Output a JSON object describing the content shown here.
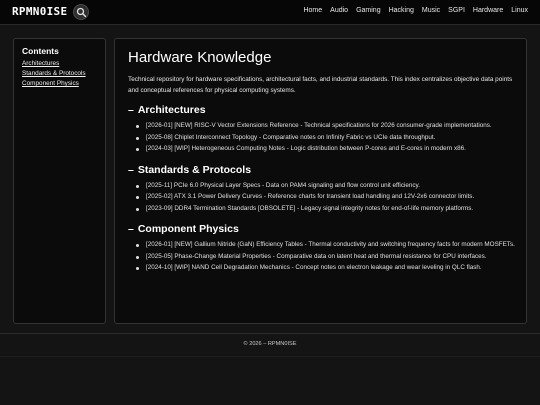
{
  "header": {
    "brand": "RPMN0ISE",
    "nav": [
      "Home",
      "Audio",
      "Gaming",
      "Hacking",
      "Music",
      "SGPI",
      "Hardware",
      "Linux"
    ]
  },
  "sidebar": {
    "title": "Contents",
    "links": [
      "Architectures",
      "Standards & Protocols",
      "Component Physics"
    ]
  },
  "main": {
    "title": "Hardware Knowledge",
    "intro": "Technical repository for hardware specifications, architectural facts, and industrial standards. This index centralizes objective data points and conceptual references for physical computing systems.",
    "sections": [
      {
        "heading": "Architectures",
        "items": [
          "[2026-01] [NEW] RISC-V Vector Extensions Reference - Technical specifications for 2026 consumer-grade implementations.",
          "[2025-08] Chiplet Interconnect Topology - Comparative notes on Infinity Fabric vs UCIe data throughput.",
          "[2024-03] [WIP] Heterogeneous Computing Notes - Logic distribution between P-cores and E-cores in modern x86."
        ]
      },
      {
        "heading": "Standards & Protocols",
        "items": [
          "[2025-11] PCIe 6.0 Physical Layer Specs - Data on PAM4 signaling and flow control unit efficiency.",
          "[2025-02] ATX 3.1 Power Delivery Curves - Reference charts for transient load handling and 12V-2x6 connector limits.",
          "[2023-09] DDR4 Termination Standards [OBSOLETE] - Legacy signal integrity notes for end-of-life memory platforms."
        ]
      },
      {
        "heading": "Component Physics",
        "items": [
          "[2026-01] [NEW] Gallium Nitride (GaN) Efficiency Tables - Thermal conductivity and switching frequency facts for modern MOSFETs.",
          "[2025-05] Phase-Change Material Properties - Comparative data on latent heat and thermal resistance for CPU interfaces.",
          "[2024-10] [WIP] NAND Cell Degradation Mechanics - Concept notes on electron leakage and wear leveling in QLC flash."
        ]
      }
    ]
  },
  "footer": {
    "text": "© 2026 – RPMN0ISE"
  }
}
